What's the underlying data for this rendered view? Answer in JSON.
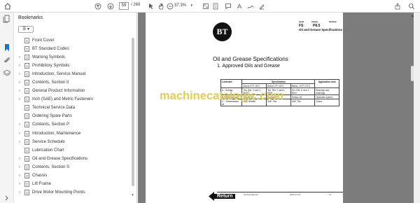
{
  "toolbar": {
    "page_current": "59",
    "page_total": "/ 268",
    "zoom": "37.3%"
  },
  "bookmarks": {
    "title": "Bookmarks",
    "close": "×",
    "options": "☰ ▾",
    "items": [
      {
        "label": "Front Cover",
        "expandable": false
      },
      {
        "label": "BT Standard Codes",
        "expandable": false
      },
      {
        "label": "Warning Symbols",
        "expandable": true
      },
      {
        "label": "Prohibitory Symbols",
        "expandable": true
      },
      {
        "label": "Introduction, Service Manual",
        "expandable": true
      },
      {
        "label": "Contents, Section II",
        "expandable": true
      },
      {
        "label": "General Product Information",
        "expandable": true
      },
      {
        "label": "Inch (SAE) and Metric Fasteners",
        "expandable": true
      },
      {
        "label": "Technical Service Data",
        "expandable": false
      },
      {
        "label": "Ordering Spare Parts",
        "expandable": false
      },
      {
        "label": "Contents, Section P",
        "expandable": true
      },
      {
        "label": "Introduction, Maintenance",
        "expandable": true
      },
      {
        "label": "Service Schedule",
        "expandable": true
      },
      {
        "label": "Lubrication Chart",
        "expandable": false
      },
      {
        "label": "Oil and Grease Specifications",
        "expandable": true
      },
      {
        "label": "Contents, Section S",
        "expandable": true
      },
      {
        "label": "Chassis",
        "expandable": true
      },
      {
        "label": "Lift Frame",
        "expandable": true
      },
      {
        "label": "Drive Motor Mounting Points",
        "expandable": true
      }
    ]
  },
  "page": {
    "logo": "BT",
    "header_fs": "FS",
    "header_p": "P8.5",
    "header_sub": "Oil and Grease Specifications",
    "title": "Oil and Grease Specifications",
    "heading": "1. Approved Oils and Grease",
    "table": {
      "headers": [
        "Lubricant",
        "Specification",
        "Application area"
      ],
      "subheaders": [
        "",
        "Above 0°F/-18°C",
        "Below 0°F/-18°C",
        "Below -10°F/-23°C",
        ""
      ],
      "rows": [
        [
          "A - Grease",
          "Tex. Ret. C and 1 8000",
          "Tex. Ret. C and 1 8000",
          "Tex. Ret. C and 1 8000",
          "Bearings and bushings"
        ],
        [
          "B - Hydraulic oil",
          "Suncor TH",
          "Suncor TH",
          "Texaco 15",
          "Hydraulic system"
        ],
        [
          "C - Transmission oil",
          "SAE 30wt80",
          "SAE 75w",
          "SAE 75w",
          "Gears"
        ]
      ]
    },
    "footer_left": "Service Manual",
    "footer_mid": "1997-07-15",
    "footer_right": "27",
    "return_label": "Return"
  },
  "watermark": "machinecatalogic.com"
}
